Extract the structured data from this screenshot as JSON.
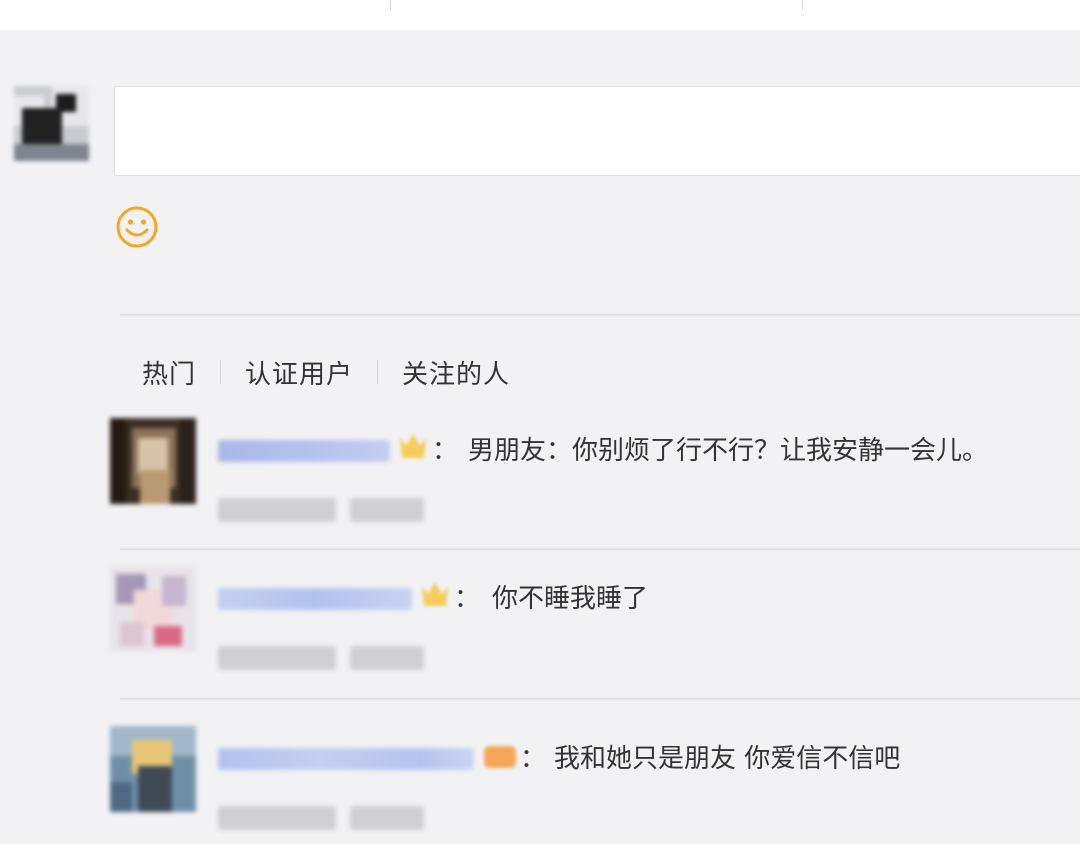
{
  "composer": {
    "input_value": "",
    "emoji_icon": "smiley-icon"
  },
  "filter_tabs": [
    {
      "label": "热门"
    },
    {
      "label": "认证用户"
    },
    {
      "label": "关注的人"
    }
  ],
  "comments": [
    {
      "separator": "：",
      "text": "男朋友：你别烦了行不行？让我安静一会儿。",
      "badge_icon": "member-crown-icon",
      "badge_color": "#f5cd5a"
    },
    {
      "separator": "：",
      "text": "你不睡我睡了",
      "badge_icon": "member-crown-icon",
      "badge_color": "#f5cd5a"
    },
    {
      "separator": "：",
      "text": "我和她只是朋友 你爱信不信吧",
      "badge_icon": "member-badge-icon",
      "badge_color": "#f6a85a"
    }
  ]
}
